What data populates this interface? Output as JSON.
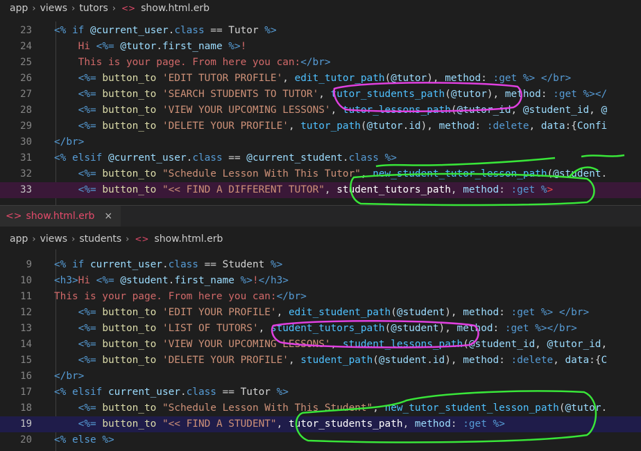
{
  "top_breadcrumb": {
    "parts": [
      "app",
      "views",
      "tutors"
    ],
    "file": "show.html.erb"
  },
  "bottom_breadcrumb": {
    "parts": [
      "app",
      "views",
      "students"
    ],
    "file": "show.html.erb"
  },
  "bottom_tab": {
    "label": "show.html.erb",
    "close": "×"
  },
  "top_lines": [
    {
      "n": "23",
      "tokens": [
        {
          "c": "k",
          "t": "<%"
        },
        {
          "c": "m",
          "t": " "
        },
        {
          "c": "k",
          "t": "if"
        },
        {
          "c": "m",
          "t": " "
        },
        {
          "c": "v",
          "t": "@current_user"
        },
        {
          "c": "m",
          "t": "."
        },
        {
          "c": "k",
          "t": "class"
        },
        {
          "c": "m",
          "t": " == Tutor "
        },
        {
          "c": "k",
          "t": "%>"
        }
      ]
    },
    {
      "n": "24",
      "tokens": [
        {
          "c": "m",
          "t": "    "
        },
        {
          "c": "b",
          "t": "Hi "
        },
        {
          "c": "k",
          "t": "<%="
        },
        {
          "c": "m",
          "t": " "
        },
        {
          "c": "v",
          "t": "@tutor"
        },
        {
          "c": "m",
          "t": "."
        },
        {
          "c": "v",
          "t": "first_name"
        },
        {
          "c": "m",
          "t": " "
        },
        {
          "c": "k",
          "t": "%>"
        },
        {
          "c": "b",
          "t": "!"
        }
      ]
    },
    {
      "n": "25",
      "tokens": [
        {
          "c": "m",
          "t": "    "
        },
        {
          "c": "b",
          "t": "This is your page. From here you can:"
        },
        {
          "c": "t",
          "t": "</br>"
        }
      ]
    },
    {
      "n": "26",
      "tokens": [
        {
          "c": "m",
          "t": "    "
        },
        {
          "c": "k",
          "t": "<%="
        },
        {
          "c": "m",
          "t": " "
        },
        {
          "c": "f",
          "t": "button_to"
        },
        {
          "c": "m",
          "t": " "
        },
        {
          "c": "s",
          "t": "'EDIT TUTOR PROFILE'"
        },
        {
          "c": "m",
          "t": ", "
        },
        {
          "c": "n",
          "t": "edit_tutor_path"
        },
        {
          "c": "m",
          "t": "("
        },
        {
          "c": "v",
          "t": "@tutor"
        },
        {
          "c": "m",
          "t": "), "
        },
        {
          "c": "v",
          "t": "method"
        },
        {
          "c": "m",
          "t": ": "
        },
        {
          "c": "c",
          "t": ":get"
        },
        {
          "c": "m",
          "t": " "
        },
        {
          "c": "k",
          "t": "%>"
        },
        {
          "c": "m",
          "t": " "
        },
        {
          "c": "t",
          "t": "</br>"
        }
      ]
    },
    {
      "n": "27",
      "tokens": [
        {
          "c": "m",
          "t": "    "
        },
        {
          "c": "k",
          "t": "<%="
        },
        {
          "c": "m",
          "t": " "
        },
        {
          "c": "f",
          "t": "button_to"
        },
        {
          "c": "m",
          "t": " "
        },
        {
          "c": "s",
          "t": "'SEARCH STUDENTS TO TUTOR'"
        },
        {
          "c": "m",
          "t": ", "
        },
        {
          "c": "n",
          "t": "tutor_students_path"
        },
        {
          "c": "m",
          "t": "("
        },
        {
          "c": "v",
          "t": "@tutor"
        },
        {
          "c": "m",
          "t": "), "
        },
        {
          "c": "v",
          "t": "method"
        },
        {
          "c": "m",
          "t": ": "
        },
        {
          "c": "c",
          "t": ":get"
        },
        {
          "c": "m",
          "t": " "
        },
        {
          "c": "k",
          "t": "%>"
        },
        {
          "c": "t",
          "t": "</"
        }
      ]
    },
    {
      "n": "28",
      "tokens": [
        {
          "c": "m",
          "t": "    "
        },
        {
          "c": "k",
          "t": "<%="
        },
        {
          "c": "m",
          "t": " "
        },
        {
          "c": "f",
          "t": "button_to"
        },
        {
          "c": "m",
          "t": " "
        },
        {
          "c": "s",
          "t": "'VIEW YOUR UPCOMING LESSONS'"
        },
        {
          "c": "m",
          "t": ", "
        },
        {
          "c": "n",
          "t": "tutor_lessons_path"
        },
        {
          "c": "m",
          "t": "("
        },
        {
          "c": "v",
          "t": "@tutor_id"
        },
        {
          "c": "m",
          "t": ", "
        },
        {
          "c": "v",
          "t": "@student_id"
        },
        {
          "c": "m",
          "t": ", "
        },
        {
          "c": "v",
          "t": "@"
        }
      ]
    },
    {
      "n": "29",
      "tokens": [
        {
          "c": "m",
          "t": "    "
        },
        {
          "c": "k",
          "t": "<%="
        },
        {
          "c": "m",
          "t": " "
        },
        {
          "c": "f",
          "t": "button_to"
        },
        {
          "c": "m",
          "t": " "
        },
        {
          "c": "s",
          "t": "'DELETE YOUR PROFILE'"
        },
        {
          "c": "m",
          "t": ", "
        },
        {
          "c": "n",
          "t": "tutor_path"
        },
        {
          "c": "m",
          "t": "("
        },
        {
          "c": "v",
          "t": "@tutor"
        },
        {
          "c": "m",
          "t": "."
        },
        {
          "c": "v",
          "t": "id"
        },
        {
          "c": "m",
          "t": "), "
        },
        {
          "c": "v",
          "t": "method"
        },
        {
          "c": "m",
          "t": ": "
        },
        {
          "c": "c",
          "t": ":delete"
        },
        {
          "c": "m",
          "t": ", "
        },
        {
          "c": "v",
          "t": "data"
        },
        {
          "c": "m",
          "t": ":{"
        },
        {
          "c": "v",
          "t": "Confi"
        }
      ]
    },
    {
      "n": "30",
      "tokens": [
        {
          "c": "t",
          "t": "</br>"
        }
      ]
    },
    {
      "n": "31",
      "tokens": [
        {
          "c": "k",
          "t": "<%"
        },
        {
          "c": "m",
          "t": " "
        },
        {
          "c": "k",
          "t": "elsif"
        },
        {
          "c": "m",
          "t": " "
        },
        {
          "c": "v",
          "t": "@current_user"
        },
        {
          "c": "m",
          "t": "."
        },
        {
          "c": "k",
          "t": "class"
        },
        {
          "c": "m",
          "t": " == "
        },
        {
          "c": "v",
          "t": "@current_student"
        },
        {
          "c": "m",
          "t": "."
        },
        {
          "c": "k",
          "t": "class"
        },
        {
          "c": "m",
          "t": " "
        },
        {
          "c": "k",
          "t": "%>"
        }
      ]
    },
    {
      "n": "32",
      "tokens": [
        {
          "c": "m",
          "t": "    "
        },
        {
          "c": "k",
          "t": "<%="
        },
        {
          "c": "m",
          "t": " "
        },
        {
          "c": "f",
          "t": "button_to"
        },
        {
          "c": "m",
          "t": " "
        },
        {
          "c": "s",
          "t": "\"Schedule Lesson With This Tutor\""
        },
        {
          "c": "m",
          "t": ", "
        },
        {
          "c": "n",
          "t": "new_student_tutor_lesson_path"
        },
        {
          "c": "m",
          "t": "("
        },
        {
          "c": "v",
          "t": "@student"
        },
        {
          "c": "m",
          "t": "."
        }
      ]
    },
    {
      "n": "33",
      "tokens": [
        {
          "c": "m",
          "t": "    "
        },
        {
          "c": "k",
          "t": "<%="
        },
        {
          "c": "m",
          "t": " "
        },
        {
          "c": "f",
          "t": "button_to"
        },
        {
          "c": "m",
          "t": " "
        },
        {
          "c": "s",
          "t": "\"<< FIND A DIFFERENT TUTOR\""
        },
        {
          "c": "m",
          "t": ", "
        },
        {
          "c": "w",
          "t": "student_tutors_path"
        },
        {
          "c": "m",
          "t": ", "
        },
        {
          "c": "v",
          "t": "method"
        },
        {
          "c": "m",
          "t": ": "
        },
        {
          "c": "c",
          "t": ":get"
        },
        {
          "c": "m",
          "t": " "
        },
        {
          "c": "k",
          "t": "%"
        },
        {
          "c": "r",
          "t": ">"
        }
      ]
    }
  ],
  "bottom_lines": [
    {
      "n": "9",
      "tokens": [
        {
          "c": "k",
          "t": "<%"
        },
        {
          "c": "m",
          "t": " "
        },
        {
          "c": "k",
          "t": "if"
        },
        {
          "c": "m",
          "t": " "
        },
        {
          "c": "v",
          "t": "current_user"
        },
        {
          "c": "m",
          "t": "."
        },
        {
          "c": "k",
          "t": "class"
        },
        {
          "c": "m",
          "t": " == Student "
        },
        {
          "c": "k",
          "t": "%>"
        }
      ]
    },
    {
      "n": "10",
      "tokens": [
        {
          "c": "t",
          "t": "<h3>"
        },
        {
          "c": "b",
          "t": "Hi "
        },
        {
          "c": "k",
          "t": "<%="
        },
        {
          "c": "m",
          "t": " "
        },
        {
          "c": "v",
          "t": "@student"
        },
        {
          "c": "m",
          "t": "."
        },
        {
          "c": "v",
          "t": "first_name"
        },
        {
          "c": "m",
          "t": " "
        },
        {
          "c": "k",
          "t": "%>"
        },
        {
          "c": "b",
          "t": "!"
        },
        {
          "c": "t",
          "t": "</h3>"
        }
      ]
    },
    {
      "n": "11",
      "tokens": [
        {
          "c": "b",
          "t": "This is your page. From here you can:"
        },
        {
          "c": "t",
          "t": "</br>"
        }
      ]
    },
    {
      "n": "12",
      "tokens": [
        {
          "c": "m",
          "t": "    "
        },
        {
          "c": "k",
          "t": "<%="
        },
        {
          "c": "m",
          "t": " "
        },
        {
          "c": "f",
          "t": "button_to"
        },
        {
          "c": "m",
          "t": " "
        },
        {
          "c": "s",
          "t": "'EDIT YOUR PROFILE'"
        },
        {
          "c": "m",
          "t": ", "
        },
        {
          "c": "n",
          "t": "edit_student_path"
        },
        {
          "c": "m",
          "t": "("
        },
        {
          "c": "v",
          "t": "@student"
        },
        {
          "c": "m",
          "t": "), "
        },
        {
          "c": "v",
          "t": "method"
        },
        {
          "c": "m",
          "t": ": "
        },
        {
          "c": "c",
          "t": ":get"
        },
        {
          "c": "m",
          "t": " "
        },
        {
          "c": "k",
          "t": "%>"
        },
        {
          "c": "m",
          "t": " "
        },
        {
          "c": "t",
          "t": "</br>"
        }
      ]
    },
    {
      "n": "13",
      "tokens": [
        {
          "c": "m",
          "t": "    "
        },
        {
          "c": "k",
          "t": "<%="
        },
        {
          "c": "m",
          "t": " "
        },
        {
          "c": "f",
          "t": "button_to"
        },
        {
          "c": "m",
          "t": " "
        },
        {
          "c": "s",
          "t": "'LIST OF TUTORS'"
        },
        {
          "c": "m",
          "t": ", "
        },
        {
          "c": "n",
          "t": "student_tutors_path"
        },
        {
          "c": "m",
          "t": "("
        },
        {
          "c": "v",
          "t": "@student"
        },
        {
          "c": "m",
          "t": "), "
        },
        {
          "c": "v",
          "t": "method"
        },
        {
          "c": "m",
          "t": ": "
        },
        {
          "c": "c",
          "t": ":get"
        },
        {
          "c": "m",
          "t": " "
        },
        {
          "c": "k",
          "t": "%>"
        },
        {
          "c": "t",
          "t": "</br>"
        }
      ]
    },
    {
      "n": "14",
      "tokens": [
        {
          "c": "m",
          "t": "    "
        },
        {
          "c": "k",
          "t": "<%="
        },
        {
          "c": "m",
          "t": " "
        },
        {
          "c": "f",
          "t": "button_to"
        },
        {
          "c": "m",
          "t": " "
        },
        {
          "c": "s",
          "t": "'VIEW YOUR UPCOMING LESSONS'"
        },
        {
          "c": "m",
          "t": ", "
        },
        {
          "c": "n",
          "t": "student_lessons_path"
        },
        {
          "c": "m",
          "t": "("
        },
        {
          "c": "v",
          "t": "@student_id"
        },
        {
          "c": "m",
          "t": ", "
        },
        {
          "c": "v",
          "t": "@tutor_id"
        },
        {
          "c": "m",
          "t": ","
        }
      ]
    },
    {
      "n": "15",
      "tokens": [
        {
          "c": "m",
          "t": "    "
        },
        {
          "c": "k",
          "t": "<%="
        },
        {
          "c": "m",
          "t": " "
        },
        {
          "c": "f",
          "t": "button_to"
        },
        {
          "c": "m",
          "t": " "
        },
        {
          "c": "s",
          "t": "'DELETE YOUR PROFILE'"
        },
        {
          "c": "m",
          "t": ", "
        },
        {
          "c": "n",
          "t": "student_path"
        },
        {
          "c": "m",
          "t": "("
        },
        {
          "c": "v",
          "t": "@student"
        },
        {
          "c": "m",
          "t": "."
        },
        {
          "c": "v",
          "t": "id"
        },
        {
          "c": "m",
          "t": "), "
        },
        {
          "c": "v",
          "t": "method"
        },
        {
          "c": "m",
          "t": ": "
        },
        {
          "c": "c",
          "t": ":delete"
        },
        {
          "c": "m",
          "t": ", "
        },
        {
          "c": "v",
          "t": "data"
        },
        {
          "c": "m",
          "t": ":{"
        },
        {
          "c": "v",
          "t": "C"
        }
      ]
    },
    {
      "n": "16",
      "tokens": [
        {
          "c": "t",
          "t": "</br>"
        }
      ]
    },
    {
      "n": "17",
      "tokens": [
        {
          "c": "k",
          "t": "<%"
        },
        {
          "c": "m",
          "t": " "
        },
        {
          "c": "k",
          "t": "elsif"
        },
        {
          "c": "m",
          "t": " "
        },
        {
          "c": "v",
          "t": "current_user"
        },
        {
          "c": "m",
          "t": "."
        },
        {
          "c": "k",
          "t": "class"
        },
        {
          "c": "m",
          "t": " == Tutor "
        },
        {
          "c": "k",
          "t": "%>"
        }
      ]
    },
    {
      "n": "18",
      "tokens": [
        {
          "c": "m",
          "t": "    "
        },
        {
          "c": "k",
          "t": "<%="
        },
        {
          "c": "m",
          "t": " "
        },
        {
          "c": "f",
          "t": "button_to"
        },
        {
          "c": "m",
          "t": " "
        },
        {
          "c": "s",
          "t": "\"Schedule Lesson With This Student\""
        },
        {
          "c": "m",
          "t": ", "
        },
        {
          "c": "n",
          "t": "new_tutor_student_lesson_path"
        },
        {
          "c": "m",
          "t": "("
        },
        {
          "c": "v",
          "t": "@tutor"
        },
        {
          "c": "m",
          "t": "."
        }
      ]
    },
    {
      "n": "19",
      "tokens": [
        {
          "c": "m",
          "t": "    "
        },
        {
          "c": "k",
          "t": "<%="
        },
        {
          "c": "m",
          "t": " "
        },
        {
          "c": "f",
          "t": "button_to"
        },
        {
          "c": "m",
          "t": " "
        },
        {
          "c": "s",
          "t": "\"<< FIND A STUDENT\""
        },
        {
          "c": "m",
          "t": ", "
        },
        {
          "c": "w",
          "t": "tutor_students_path"
        },
        {
          "c": "m",
          "t": ", "
        },
        {
          "c": "v",
          "t": "method"
        },
        {
          "c": "m",
          "t": ": "
        },
        {
          "c": "c",
          "t": ":get"
        },
        {
          "c": "m",
          "t": " "
        },
        {
          "c": "k",
          "t": "%>"
        }
      ]
    },
    {
      "n": "20",
      "tokens": [
        {
          "c": "k",
          "t": "<%"
        },
        {
          "c": "m",
          "t": " "
        },
        {
          "c": "k",
          "t": "else"
        },
        {
          "c": "m",
          "t": " "
        },
        {
          "c": "k",
          "t": "%>"
        }
      ]
    }
  ],
  "colors": {
    "editor_bg": "#1e1e1e",
    "annotation_magenta": "#e040e0",
    "annotation_green": "#39e639"
  }
}
